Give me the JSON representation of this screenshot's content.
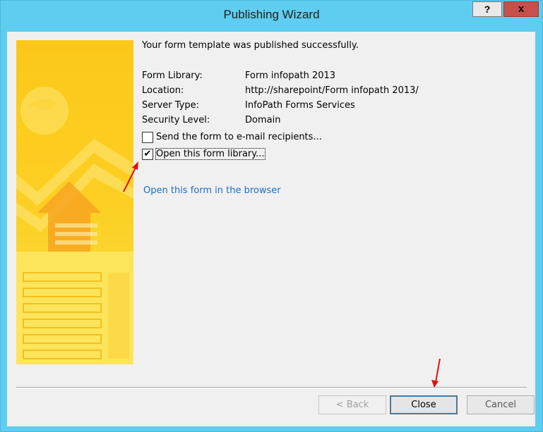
{
  "window": {
    "title": "Publishing Wizard",
    "help_label": "?",
    "close_label": "x"
  },
  "message": "Your form template was published successfully.",
  "info": [
    {
      "label": "Form Library:",
      "value": "Form infopath 2013"
    },
    {
      "label": "Location:",
      "value": "http://sharepoint/Form infopath 2013/"
    },
    {
      "label": "Server Type:",
      "value": "InfoPath Forms Services"
    },
    {
      "label": "Security Level:",
      "value": "Domain"
    }
  ],
  "options": {
    "send_email": {
      "label": "Send the form to e-mail recipients...",
      "checked": false
    },
    "open_library": {
      "label": "Open this form library...",
      "checked": true
    }
  },
  "link": "Open this form in the browser",
  "buttons": {
    "back": "< Back",
    "close": "Close",
    "cancel": "Cancel"
  },
  "colors": {
    "titlebar": "#5fcdef",
    "banner": "#fcd21c",
    "link": "#1e6ec2",
    "annotation_arrow": "#e01010"
  }
}
